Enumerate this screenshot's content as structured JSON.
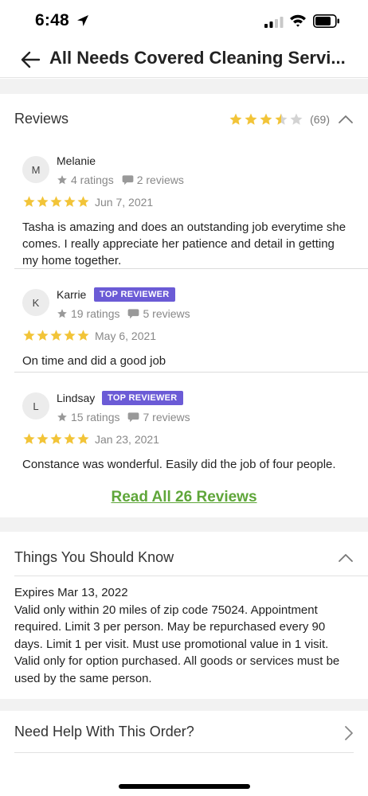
{
  "status_bar": {
    "time": "6:48"
  },
  "header": {
    "title": "All Needs Covered Cleaning Servi..."
  },
  "reviews": {
    "title": "Reviews",
    "overall_rating": 3.5,
    "count_label": "(69)",
    "items": [
      {
        "initial": "M",
        "name": "Melanie",
        "badge": "",
        "ratings": "4 ratings",
        "review_count": "2 reviews",
        "stars": 5,
        "date": "Jun 7, 2021",
        "text": "Tasha is amazing and does an outstanding job everytime she comes. I really appreciate her patience and detail in getting my home together."
      },
      {
        "initial": "K",
        "name": "Karrie",
        "badge": "TOP REVIEWER",
        "ratings": "19 ratings",
        "review_count": "5 reviews",
        "stars": 5,
        "date": "May 6, 2021",
        "text": "On time and did a good job"
      },
      {
        "initial": "L",
        "name": "Lindsay",
        "badge": "TOP REVIEWER",
        "ratings": "15 ratings",
        "review_count": "7 reviews",
        "stars": 5,
        "date": "Jan 23, 2021",
        "text": "Constance was wonderful. Easily did the job of four people."
      }
    ],
    "read_all_label": "Read All 26 Reviews"
  },
  "things_to_know": {
    "title": "Things You Should Know",
    "text": "Expires Mar 13, 2022\nValid only within 20 miles of zip code 75024. Appointment required. Limit 3 per person. May be repurchased every 90 days. Limit 1 per visit. Must use promotional value in 1 visit. Valid only for option purchased. All goods or services must be used by the same person."
  },
  "help": {
    "title": "Need Help With This Order?"
  },
  "colors": {
    "star": "#f2c438",
    "star_empty": "#d3d3d3",
    "badge": "#6b5bd6",
    "link": "#5fa63a",
    "section_gap": "#f2f2f2"
  }
}
